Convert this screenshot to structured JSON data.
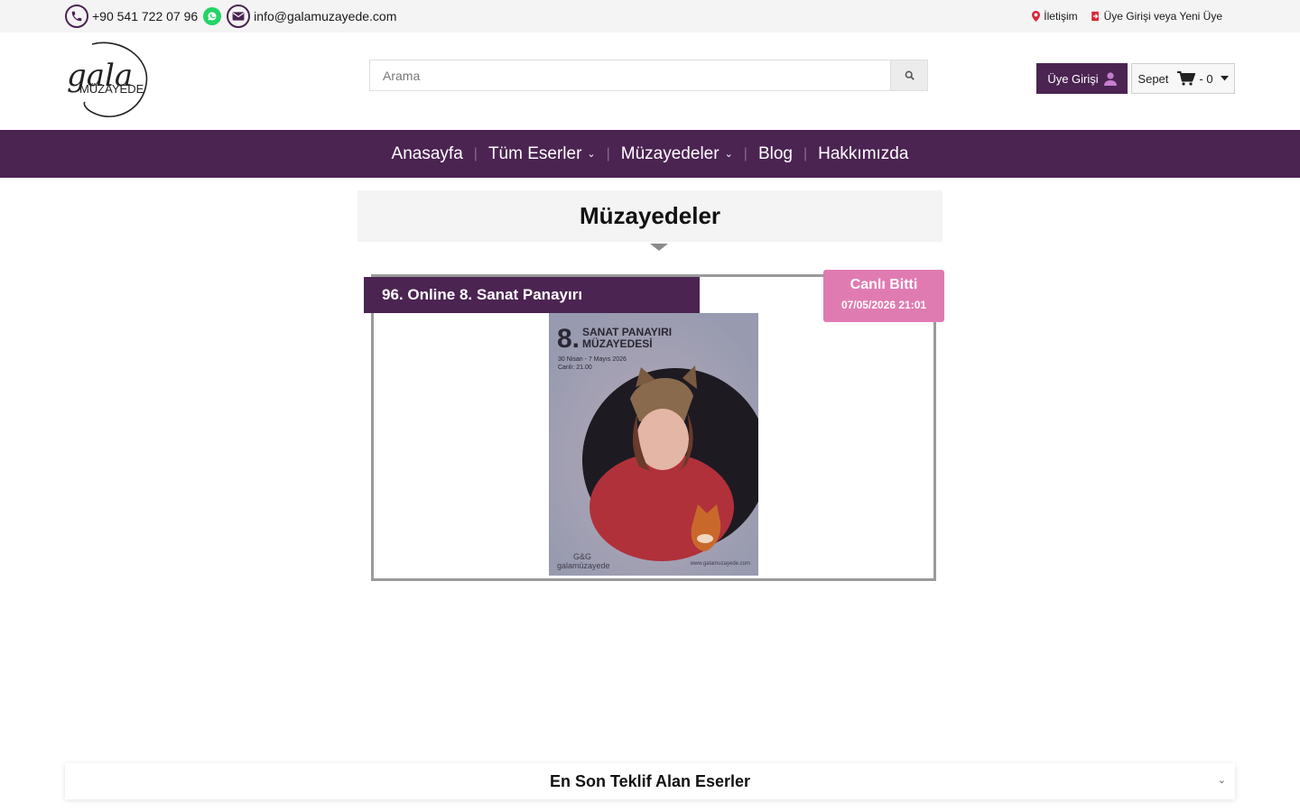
{
  "topbar": {
    "phone": "+90 541 722 07 96",
    "email": "info@galamuzayede.com",
    "contact_label": "İletişim",
    "login_register_label": "Üye Girişi veya Yeni Üye"
  },
  "header": {
    "logo_script": "gala",
    "logo_text": "MÜZAYEDE",
    "search_placeholder": "Arama",
    "login_label": "Üye Girişi",
    "cart_label": "Sepet",
    "cart_count": "- 0"
  },
  "nav": {
    "items": [
      {
        "label": "Anasayfa"
      },
      {
        "label": "Tüm Eserler"
      },
      {
        "label": "Müzayedeler"
      },
      {
        "label": "Blog"
      },
      {
        "label": "Hakkımızda"
      }
    ]
  },
  "main": {
    "page_title": "Müzayedeler",
    "auction": {
      "title": "96. Online 8. Sanat Panayırı",
      "status": "Canlı Bitti",
      "date": "07/05/2026 21:01",
      "poster": {
        "number": "8.",
        "line1": "SANAT PANAYIRI",
        "line2": "MÜZAYEDESİ",
        "dates": "30 Nisan - 7 Mayıs 2026",
        "live": "Canlı: 21.00",
        "brand1": "G&G",
        "brand2": "galamüzayede",
        "site": "www.galamuzayede.com"
      }
    }
  },
  "footer_section": {
    "title": "En Son Teklif Alan Eserler"
  },
  "colors": {
    "brand": "#4b2452",
    "status": "#e07bb2"
  }
}
